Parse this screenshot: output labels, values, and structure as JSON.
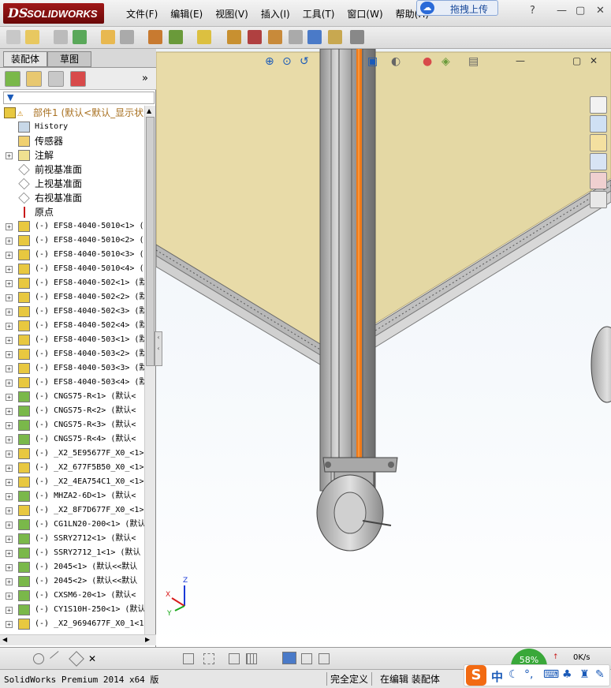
{
  "app": {
    "logo_ds": "DS",
    "logo_text": "SOLIDWORKS"
  },
  "menu": [
    "文件(F)",
    "编辑(E)",
    "视图(V)",
    "插入(I)",
    "工具(T)",
    "窗口(W)",
    "帮助(H)"
  ],
  "upload": {
    "label": "拖拽上传"
  },
  "window_controls": {
    "help": "?",
    "minimize": "—",
    "restore": "▢",
    "close": "✕"
  },
  "panel": {
    "tabs": [
      "装配体",
      "草图"
    ],
    "filter_icon": "filter-icon",
    "root_label": "部件1  (默认<默认_显示状",
    "tree": [
      {
        "label": "History",
        "icon": "history-icon",
        "expand": false
      },
      {
        "label": "传感器",
        "icon": "sensor-icon",
        "expand": false
      },
      {
        "label": "注解",
        "icon": "annotation-icon",
        "expand": true
      },
      {
        "label": "前视基准面",
        "icon": "plane-icon",
        "expand": false
      },
      {
        "label": "上视基准面",
        "icon": "plane-icon",
        "expand": false
      },
      {
        "label": "右视基准面",
        "icon": "plane-icon",
        "expand": false
      },
      {
        "label": "原点",
        "icon": "origin-icon",
        "expand": false
      },
      {
        "label": "(-) EFS8-4040-5010<1> (",
        "icon": "part-icon",
        "expand": true
      },
      {
        "label": "(-) EFS8-4040-5010<2> (",
        "icon": "part-icon",
        "expand": true
      },
      {
        "label": "(-) EFS8-4040-5010<3> (",
        "icon": "part-icon",
        "expand": true
      },
      {
        "label": "(-) EFS8-4040-5010<4> (",
        "icon": "part-icon",
        "expand": true
      },
      {
        "label": "(-) EFS8-4040-502<1> (默",
        "icon": "part-icon",
        "expand": true
      },
      {
        "label": "(-) EFS8-4040-502<2> (默",
        "icon": "part-icon",
        "expand": true
      },
      {
        "label": "(-) EFS8-4040-502<3> (默",
        "icon": "part-icon",
        "expand": true
      },
      {
        "label": "(-) EFS8-4040-502<4> (默",
        "icon": "part-icon",
        "expand": true
      },
      {
        "label": "(-) EFS8-4040-503<1> (默",
        "icon": "part-icon",
        "expand": true
      },
      {
        "label": "(-) EFS8-4040-503<2> (默",
        "icon": "part-icon",
        "expand": true
      },
      {
        "label": "(-) EFS8-4040-503<3> (默",
        "icon": "part-icon",
        "expand": true
      },
      {
        "label": "(-) EFS8-4040-503<4> (默",
        "icon": "part-icon",
        "expand": true
      },
      {
        "label": "(-) CNGS75-R<1> (默认<",
        "icon": "assembly-icon",
        "expand": true
      },
      {
        "label": "(-) CNGS75-R<2> (默认<",
        "icon": "assembly-icon",
        "expand": true
      },
      {
        "label": "(-) CNGS75-R<3> (默认<",
        "icon": "assembly-icon",
        "expand": true
      },
      {
        "label": "(-) CNGS75-R<4> (默认<",
        "icon": "assembly-icon",
        "expand": true
      },
      {
        "label": "(-) _X2_5E95677F_X0_<1>",
        "icon": "part-icon",
        "expand": true
      },
      {
        "label": "(-) _X2_677F5B50_X0_<1>",
        "icon": "part-icon",
        "expand": true
      },
      {
        "label": "(-) _X2_4EA754C1_X0_<1>",
        "icon": "part-icon",
        "expand": true
      },
      {
        "label": "(-) MHZA2-6D<1> (默认<",
        "icon": "assembly-icon",
        "expand": true
      },
      {
        "label": "(-) _X2_8F7D677F_X0_<1>",
        "icon": "part-icon",
        "expand": true
      },
      {
        "label": "(-) CG1LN20-200<1> (默认",
        "icon": "assembly-icon",
        "expand": true
      },
      {
        "label": "(-) SSRY2712<1> (默认<",
        "icon": "assembly-icon",
        "expand": true
      },
      {
        "label": "(-) SSRY2712_1<1> (默认",
        "icon": "assembly-icon",
        "expand": true
      },
      {
        "label": "(-) 2045<1> (默认<<默认",
        "icon": "assembly-icon",
        "expand": true
      },
      {
        "label": "(-) 2045<2> (默认<<默认",
        "icon": "assembly-icon",
        "expand": true
      },
      {
        "label": "(-) CXSM6-20<1> (默认<",
        "icon": "assembly-icon",
        "expand": true
      },
      {
        "label": "(-) CY1S10H-250<1> (默认",
        "icon": "assembly-icon",
        "expand": true
      },
      {
        "label": "(-) _X2_9694677F_X0_1<1",
        "icon": "part-icon",
        "expand": true
      }
    ]
  },
  "viewport": {
    "triad_x": "X",
    "triad_y": "Y",
    "triad_z": "Z"
  },
  "status": {
    "product": "SolidWorks Premium 2014 x64 版",
    "state": "完全定义",
    "mode": "在编辑 装配体"
  },
  "tray": {
    "ime_logo": "S",
    "ime_lang": "中",
    "net_percent": "58%",
    "net_speed": "0K/s"
  },
  "colors": {
    "logo_red": "#8a1010",
    "wall": "#e8dba8",
    "frame": "#9a9a9a",
    "accent_orange": "#f07a18"
  }
}
